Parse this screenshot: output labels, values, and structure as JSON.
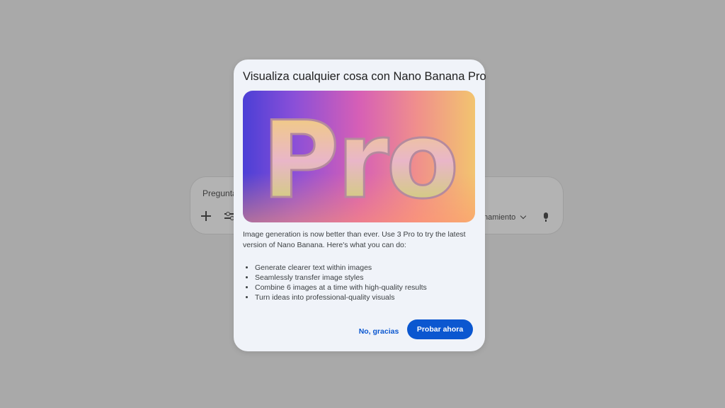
{
  "background": {
    "prompt_placeholder": "Pregunta",
    "mode_label": "namiento",
    "icons": [
      "plus-icon",
      "tools-icon",
      "chevron-down-icon",
      "microphone-icon"
    ]
  },
  "dialog": {
    "title": "Visualiza cualquier cosa con Nano Banana Pro",
    "hero_text": "Pro",
    "description": "Image generation is now better than ever. Use 3 Pro to try the latest version of Nano Banana. Here's what you can do:",
    "features": [
      "Generate clearer text within images",
      "Seamlessly transfer image styles",
      "Combine 6 images at a time with high-quality results",
      "Turn ideas into professional-quality visuals"
    ],
    "dismiss_label": "No, gracias",
    "confirm_label": "Probar ahora"
  },
  "colors": {
    "overlay": "#a9a9a9",
    "dialog_bg": "#f0f3f9",
    "accent": "#0b57d0"
  }
}
